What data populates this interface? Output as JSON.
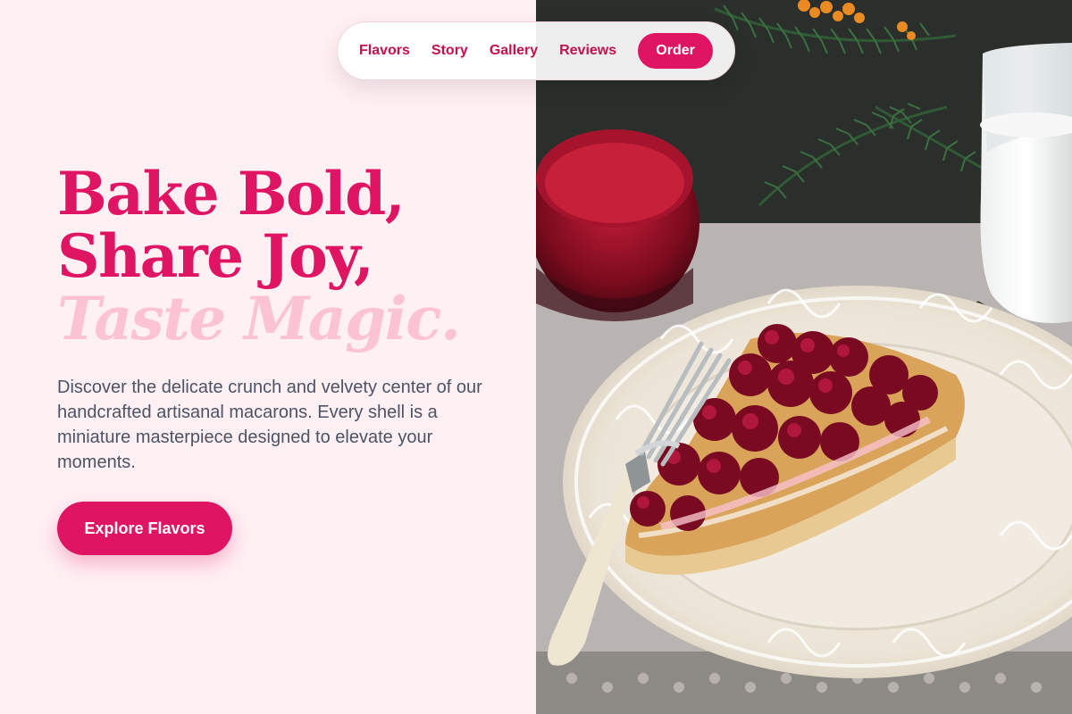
{
  "nav": {
    "links": [
      "Flavors",
      "Story",
      "Gallery",
      "Reviews"
    ],
    "order_label": "Order"
  },
  "hero": {
    "title_line1": "Bake Bold,",
    "title_line2": "Share Joy,",
    "title_line3": "Taste Magic.",
    "description": "Discover the delicate crunch and velvety center of our handcrafted artisanal macarons. Every shell is a miniature masterpiece designed to elevate your moments.",
    "cta_label": "Explore Flavors"
  },
  "colors": {
    "accent": "#df1462",
    "accent_light": "#fcc3d2",
    "background": "#fff0f4",
    "body_text": "#4c5366"
  },
  "image": {
    "subject": "cherry-tart-slice-photo"
  }
}
